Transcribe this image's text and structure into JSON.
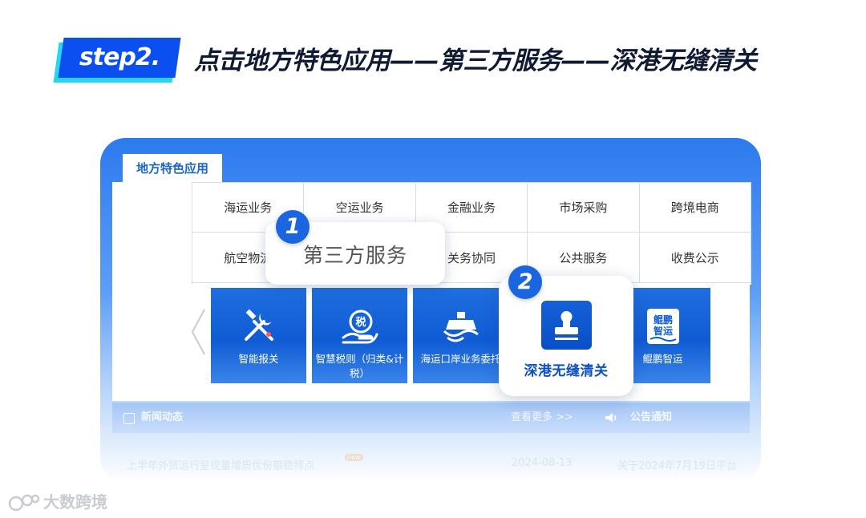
{
  "step": {
    "badge": "step2.",
    "title": "点击地方特色应用——第三方服务——深港无缝清关"
  },
  "section_tab": "地方特色应用",
  "grid": [
    [
      "海运业务",
      "空运业务",
      "金融业务",
      "市场采购",
      "跨境电商"
    ],
    [
      "航空物流",
      "",
      "关务协同",
      "公共服务",
      "收费公示"
    ]
  ],
  "tiles": [
    {
      "label": "智能报关",
      "icon": "tools-icon"
    },
    {
      "label": "智慧税则（归类&计税）",
      "icon": "tax-hand-icon"
    },
    {
      "label": "海运口岸业务委托",
      "icon": "ship-icon"
    },
    {
      "label": "深港无缝清关",
      "icon": "stamp-icon"
    },
    {
      "label": "鲲鹏智运",
      "icon": "kunpeng-logo",
      "logo_text": "鲲鹏智运"
    }
  ],
  "popup1": {
    "number": "1",
    "label": "第三方服务"
  },
  "popup2": {
    "number": "2",
    "label": "深港无缝清关"
  },
  "news_bar": {
    "news_title": "新闻动态",
    "more": "查看更多 >>",
    "notice_title": "公告通知"
  },
  "faded_row": {
    "headline": "上半年外贸运行呈现量增质优份额稳特点",
    "hot": "new",
    "date": "2024-08-13",
    "notice": "关于2024年7月19日平台"
  },
  "watermark": "大数跨境",
  "colors": {
    "primary": "#0b4ff0",
    "accent": "#25d6f2",
    "frame": "#2c7aee"
  }
}
